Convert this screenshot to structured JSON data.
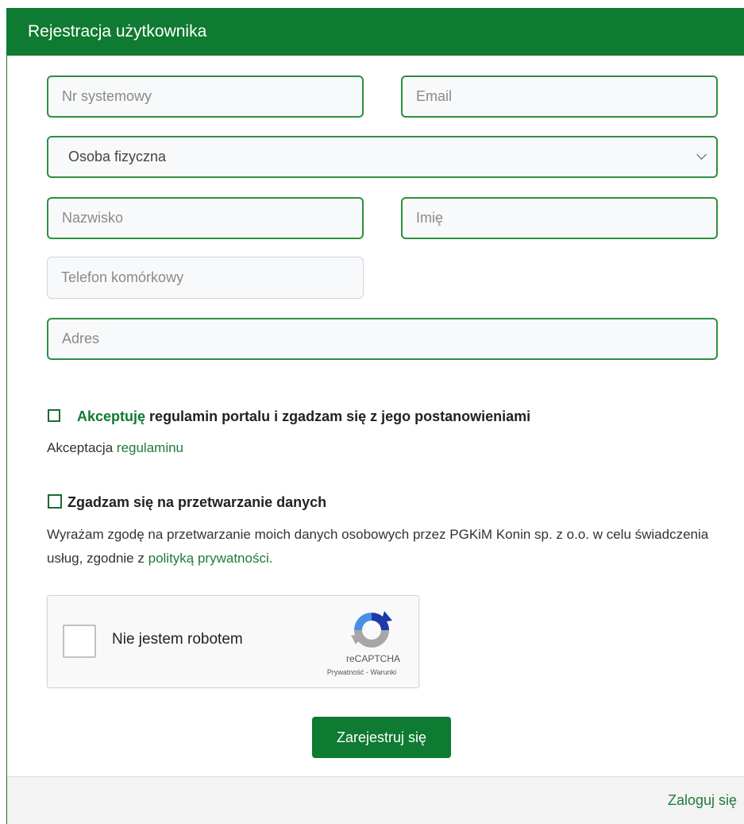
{
  "header": {
    "title": "Rejestracja użytkownika"
  },
  "fields": {
    "system_number": {
      "placeholder": "Nr systemowy"
    },
    "email": {
      "placeholder": "Email"
    },
    "person_type": {
      "selected": "Osoba fizyczna"
    },
    "last_name": {
      "placeholder": "Nazwisko"
    },
    "first_name": {
      "placeholder": "Imię"
    },
    "mobile_phone": {
      "placeholder": "Telefon komórkowy"
    },
    "address": {
      "placeholder": "Adres"
    }
  },
  "terms": {
    "label_highlight": "Akceptuję",
    "label_rest": "regulamin portalu i zgadzam się z jego postanowieniami",
    "note_prefix": "Akceptacja",
    "note_link": "regulaminu"
  },
  "privacy": {
    "label": "Zgadzam się na przetwarzanie danych",
    "text": "Wyrażam zgodę na przetwarzanie moich danych osobowych przez PGKiM Konin sp. z o.o. w celu świadczenia usług, zgodnie z",
    "link": "polityką prywatności",
    "suffix": "."
  },
  "recaptcha": {
    "label": "Nie jestem robotem",
    "brand": "reCAPTCHA",
    "links": "Prywatność - Warunki"
  },
  "submit_label": "Zarejestruj się",
  "footer": {
    "login_link": "Zaloguj się"
  },
  "colors": {
    "primary": "#0f7a31",
    "link": "#1f7a3a",
    "field_border": "#2f8f3e"
  }
}
